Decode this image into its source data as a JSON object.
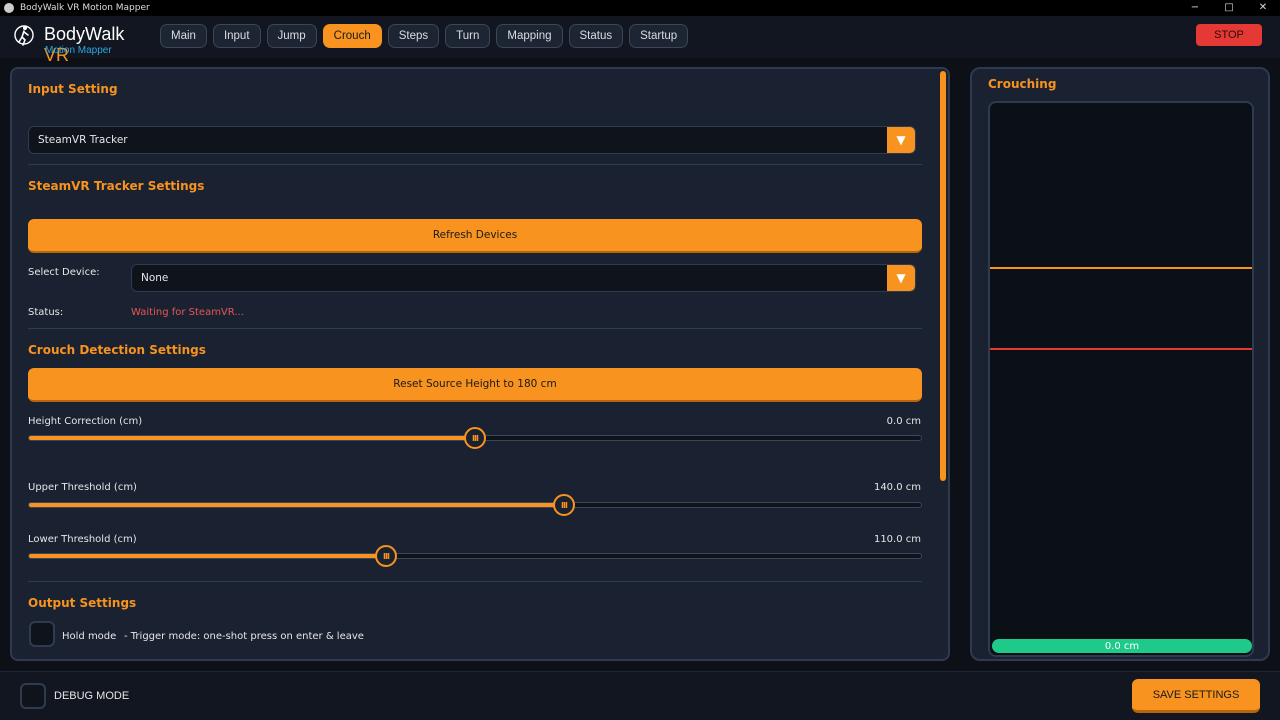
{
  "window": {
    "title": "BodyWalk VR Motion Mapper",
    "minimize": "−",
    "maximize": "□",
    "close": "✕"
  },
  "logo": {
    "main": "BodyWalk",
    "accent": "VR",
    "sub": "Motion Mapper"
  },
  "tabs": [
    "Main",
    "Input",
    "Jump",
    "Crouch",
    "Steps",
    "Turn",
    "Mapping",
    "Status",
    "Startup"
  ],
  "active_tab": "Crouch",
  "stop_label": "STOP",
  "input_setting": {
    "title": "Input Setting",
    "source": "SteamVR Tracker"
  },
  "tracker_settings": {
    "title": "SteamVR Tracker Settings",
    "refresh_label": "Refresh Devices",
    "device_label": "Select Device:",
    "device_value": "None",
    "status_label": "Status:",
    "status_value": "Waiting for SteamVR..."
  },
  "crouch_detection": {
    "title": "Crouch Detection Settings",
    "reset_label": "Reset Source Height to 180 cm",
    "sliders": [
      {
        "label": "Height Correction (cm)",
        "value": "0.0 cm",
        "fraction": 0.5
      },
      {
        "label": "Upper Threshold (cm)",
        "value": "140.0 cm",
        "fraction": 0.6
      },
      {
        "label": "Lower Threshold (cm)",
        "value": "110.0 cm",
        "fraction": 0.4
      }
    ]
  },
  "output_settings": {
    "title": "Output Settings",
    "hold_label": "Hold mode",
    "hold_desc": "- Trigger mode: one-shot press on enter & leave"
  },
  "crouching": {
    "title": "Crouching",
    "current_height": "0.0 cm"
  },
  "footer": {
    "debug_label": "DEBUG MODE",
    "save_label": "SAVE SETTINGS"
  },
  "colors": {
    "accent": "#f7931e",
    "stop": "#e53935",
    "status_error": "#e85555",
    "height_bar": "#1ec98a",
    "logo_sub": "#2aa8e0"
  }
}
